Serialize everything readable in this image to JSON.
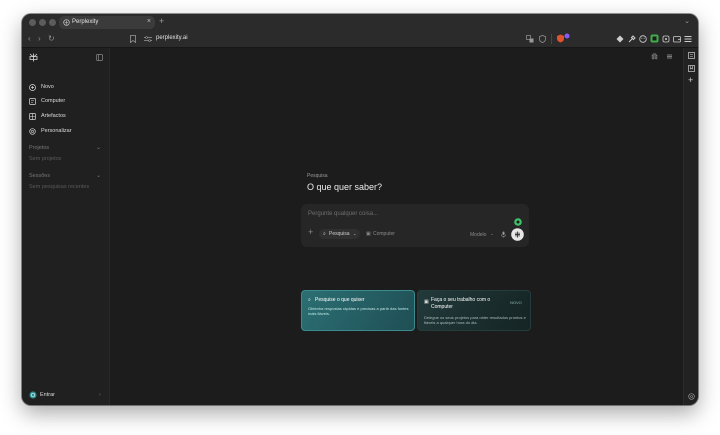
{
  "browser": {
    "tab_title": "Perplexity",
    "new_tab_symbol": "+",
    "tab_close_symbol": "×",
    "tab_menu_symbol": "⌄",
    "url": "perplexity.ai"
  },
  "sidebar": {
    "items": [
      {
        "label": "Novo"
      },
      {
        "label": "Computer"
      },
      {
        "label": "Artefactos"
      },
      {
        "label": "Personalizar"
      }
    ],
    "projects_heading": "Projetos",
    "projects_empty": "Sem projetos",
    "sessions_heading": "Sessões",
    "sessions_empty": "Sem pesquisas recentes",
    "signin_label": "Entrar"
  },
  "main": {
    "eyebrow": "Pesquisa",
    "heading": "O que quer saber?",
    "input_placeholder": "Pergunte qualquer coisa...",
    "search_pill": "Pesquisa",
    "computer_pill": "Computer",
    "model_label": "Modelo",
    "promo_search": {
      "title": "Pesquise o que quiser",
      "desc": "Obtenha respostas rápidas e precisas a partir das fontes mais fiáveis."
    },
    "promo_computer": {
      "title": "Faça o seu trabalho com o Computer",
      "badge": "NOVO",
      "desc": "Delegue os seus projetos para obter resultados prontos e fiáveis a qualquer hora do dia."
    }
  },
  "colors": {
    "window_bg": "#1c1c1c",
    "sidebar_bg": "#202020",
    "accent_teal": "#2e8a8c",
    "accent_green": "#3fc36a"
  }
}
